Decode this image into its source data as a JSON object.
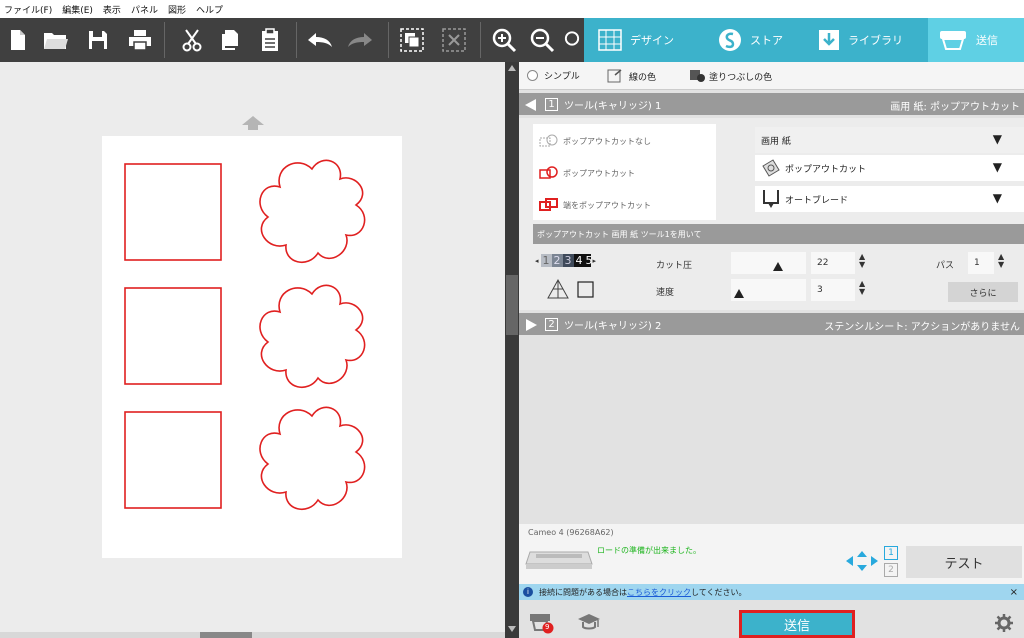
{
  "menu": [
    "ファイル(F)",
    "編集(E)",
    "表示",
    "パネル",
    "図形",
    "ヘルプ"
  ],
  "tabs": {
    "design": "デザイン",
    "store": "ストア",
    "library": "ライブラリ",
    "send": "送信"
  },
  "mode": {
    "simple": "シンプル",
    "line_color": "線の色",
    "fill_color": "塗りつぶしの色"
  },
  "tool1": {
    "number": "1",
    "title": "ツール(キャリッジ)  1",
    "summary": "画用 紙: ポップアウトカット",
    "options": [
      "ポップアウトカットなし",
      "ポップアウトカット",
      "端をポップアウトカット"
    ],
    "material": "画用 紙",
    "action": "ポップアウトカット",
    "blade": "オートブレード",
    "sub_header": "ポップアウトカット 画用 紙 ツール1を用いて",
    "blade_digits": [
      "1",
      "2",
      "3",
      "4",
      "5"
    ],
    "pressure_label": "カット圧",
    "pressure_value": "22",
    "speed_label": "速度",
    "speed_value": "3",
    "pass_label": "パス",
    "pass_value": "1",
    "more_label": "さらに"
  },
  "tool2": {
    "number": "2",
    "title": "ツール(キャリッジ)  2",
    "summary": "ステンシルシート: アクションがありません"
  },
  "device": {
    "name": "Cameo 4 (96268A62)",
    "status": "ロードの準備が出来ました。",
    "carriage_1": "1",
    "carriage_2": "2",
    "test_label": "テスト"
  },
  "info": {
    "text_before": "接続に問題がある場合は",
    "link": "こちらをクリック",
    "text_after": "してください。",
    "close": "×"
  },
  "footer": {
    "badge": "9",
    "send_label": "送信"
  },
  "colors": {
    "accent": "#3cb2cb",
    "shape_stroke": "#e02020",
    "status_green": "#1fb51f",
    "toolbar_bg": "#404040"
  }
}
